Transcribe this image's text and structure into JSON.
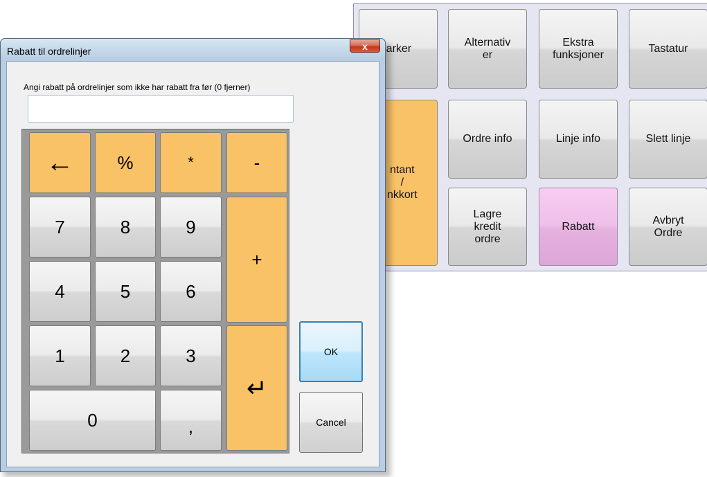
{
  "pos_panel": {
    "buttons": [
      {
        "label": "Parker"
      },
      {
        "label": "Alternativ er"
      },
      {
        "label": "Ekstra funksjoner"
      },
      {
        "label": "Tastatur"
      },
      {
        "label": "ntant / nkkort"
      },
      {
        "label": "Ordre info"
      },
      {
        "label": "Linje info"
      },
      {
        "label": "Slett linje"
      },
      {
        "label": "Lagre kredit ordre"
      },
      {
        "label": "Rabatt"
      },
      {
        "label": "Avbryt Ordre"
      }
    ]
  },
  "dialog": {
    "title": "Rabatt til ordrelinjer",
    "close_glyph": "x",
    "instruction": "Angi rabatt på ordrelinjer som ikke har rabatt fra før (0 fjerner)",
    "input_value": "",
    "keys": {
      "backspace": "←",
      "percent": "%",
      "star": "*",
      "minus": "-",
      "k7": "7",
      "k8": "8",
      "k9": "9",
      "plus": "+",
      "k4": "4",
      "k5": "5",
      "k6": "6",
      "k1": "1",
      "k2": "2",
      "k3": "3",
      "enter": "↵",
      "k0": "0",
      "comma": ","
    },
    "ok_label": "OK",
    "cancel_label": "Cancel"
  },
  "colors": {
    "orange_key": "#f9c267",
    "pink_button": "#efc0ea",
    "panel_bg": "#e6e6f2",
    "dialog_frame": "#b9cee4"
  }
}
